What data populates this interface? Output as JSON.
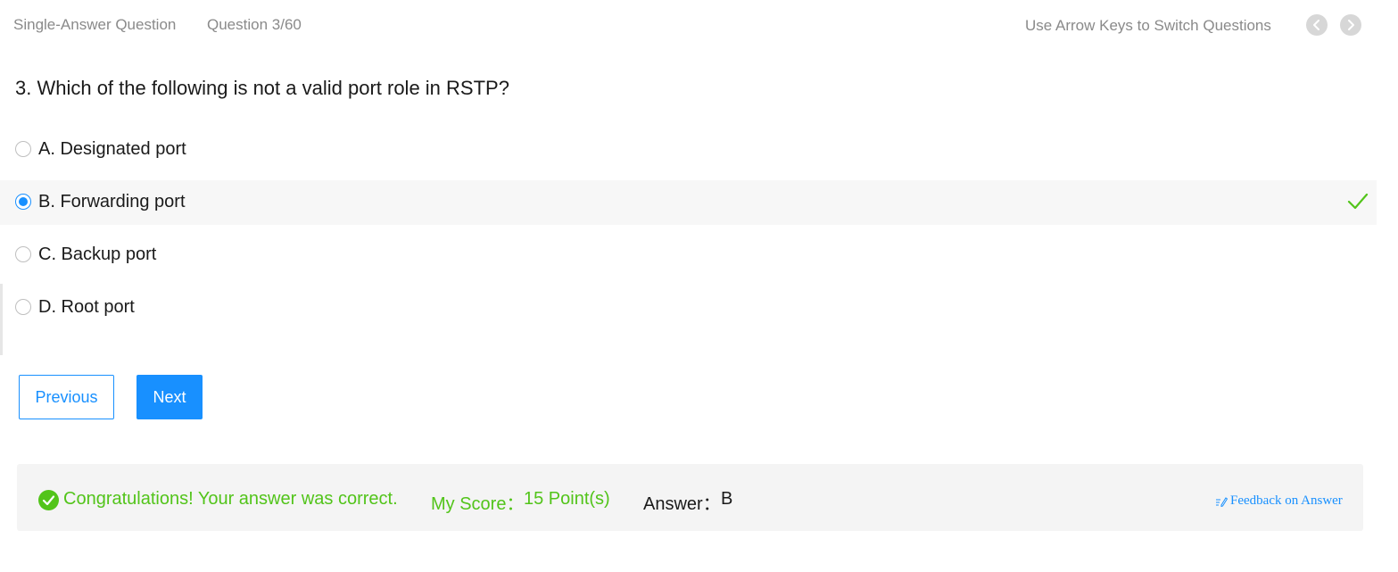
{
  "header": {
    "question_type": "Single-Answer Question",
    "question_counter": "Question 3/60",
    "hint": "Use Arrow Keys to Switch Questions",
    "prev_icon": "chevron-left-icon",
    "next_icon": "chevron-right-icon"
  },
  "question": {
    "title": "3. Which of the following is not a valid port role in RSTP?",
    "options": [
      {
        "label": "A. Designated port",
        "selected": false
      },
      {
        "label": "B. Forwarding port",
        "selected": true,
        "marked_correct": true
      },
      {
        "label": "C. Backup port",
        "selected": false
      },
      {
        "label": "D. Root port",
        "selected": false
      }
    ]
  },
  "buttons": {
    "previous": "Previous",
    "next": "Next"
  },
  "result": {
    "message": "Congratulations! Your answer was correct.",
    "score_label": "My Score：",
    "score_value": "15 Point(s)",
    "answer_label": "Answer：",
    "answer_value": "B",
    "feedback_link": "Feedback on Answer"
  },
  "colors": {
    "accent": "#1890ff",
    "success": "#52c41a",
    "muted_text": "#8a8a8a",
    "selected_row_bg": "#f7f7f7",
    "result_bg": "#f4f4f4"
  }
}
